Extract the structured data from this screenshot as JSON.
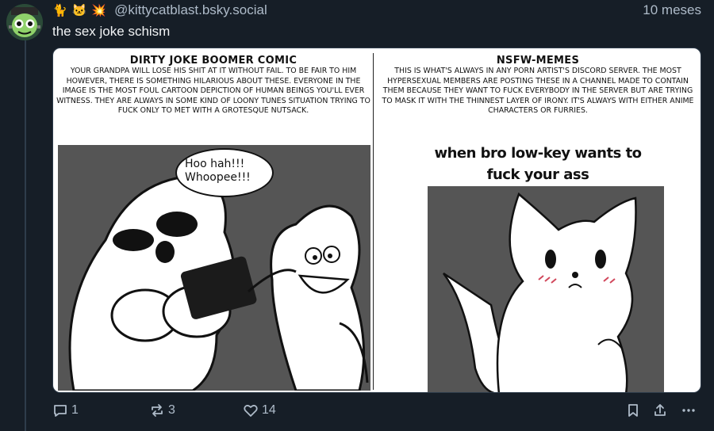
{
  "post": {
    "emojis": [
      "🐈",
      "🐱",
      "💥"
    ],
    "handle": "@kittycatblast.bsky.social",
    "time": "10 meses",
    "text": "the sex joke schism"
  },
  "meme": {
    "left": {
      "title": "DIRTY JOKE BOOMER COMIC",
      "body": "YOUR GRANDPA WILL LOSE HIS SHIT AT IT WITHOUT FAIL. TO BE FAIR TO HIM HOWEVER, THERE IS SOMETHING HILARIOUS ABOUT THESE. EVERYONE IN THE IMAGE IS THE MOST FOUL CARTOON DEPICTION OF HUMAN BEINGS YOU'LL EVER WITNESS. THEY ARE ALWAYS IN SOME KIND OF LOONY TUNES SITUATION TRYING TO FUCK ONLY TO MET WITH A GROTESQUE NUTSACK.",
      "speech": [
        "Hoo hah!!!",
        "Whoopee!!!"
      ]
    },
    "right": {
      "title": "NSFW-MEMES",
      "body": "THIS IS WHAT'S ALWAYS IN ANY PORN ARTIST'S DISCORD SERVER. THE MOST HYPERSEXUAL MEMBERS ARE POSTING THESE IN A CHANNEL MADE TO CONTAIN THEM BECAUSE THEY WANT TO FUCK EVERYBODY IN THE SERVER BUT ARE TRYING TO MASK IT WITH THE THINNEST LAYER OF IRONY. IT'S ALWAYS WITH EITHER ANIME CHARACTERS OR FURRIES.",
      "caption_line1": "when bro low-key wants to",
      "caption_line2": "fuck your ass"
    }
  },
  "actions": {
    "replies": "1",
    "reposts": "3",
    "likes": "14"
  },
  "colors": {
    "background": "#161e27",
    "muted_text": "#aebbc9",
    "thread_line": "#2e3c4b"
  },
  "icons": [
    "avatar-frankenstein",
    "reply-icon",
    "repost-icon",
    "heart-icon",
    "bookmark-icon",
    "share-icon",
    "more-icon"
  ]
}
